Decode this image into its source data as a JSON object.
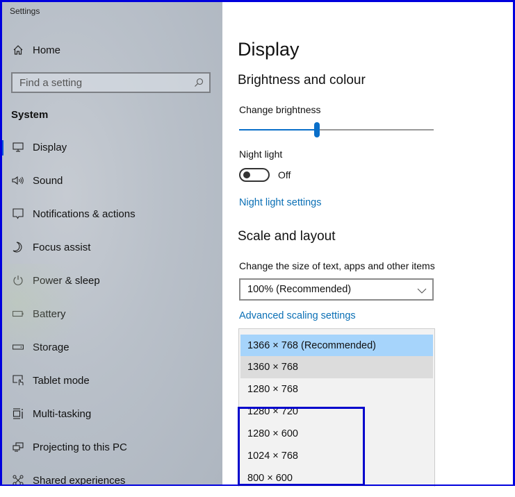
{
  "window": {
    "title": "Settings"
  },
  "sidebar": {
    "home_label": "Home",
    "search": {
      "placeholder": "Find a setting",
      "value": ""
    },
    "group_title": "System",
    "items": [
      {
        "label": "Display",
        "icon": "display-icon",
        "active": true
      },
      {
        "label": "Sound",
        "icon": "sound-icon"
      },
      {
        "label": "Notifications & actions",
        "icon": "notifications-icon"
      },
      {
        "label": "Focus assist",
        "icon": "moon-icon"
      },
      {
        "label": "Power & sleep",
        "icon": "power-icon"
      },
      {
        "label": "Battery",
        "icon": "battery-icon"
      },
      {
        "label": "Storage",
        "icon": "storage-icon"
      },
      {
        "label": "Tablet mode",
        "icon": "tablet-mode-icon"
      },
      {
        "label": "Multi-tasking",
        "icon": "multitasking-icon"
      },
      {
        "label": "Projecting to this PC",
        "icon": "projecting-icon"
      },
      {
        "label": "Shared experiences",
        "icon": "shared-experiences-icon"
      }
    ]
  },
  "main": {
    "page_title": "Display",
    "brightness_section": {
      "title": "Brightness and colour",
      "brightness_label": "Change brightness",
      "brightness_percent": 40,
      "night_light_label": "Night light",
      "night_light_state": "Off",
      "night_light_settings_link": "Night light settings"
    },
    "scale_section": {
      "title": "Scale and layout",
      "scale_label": "Change the size of text, apps and other items",
      "scale_value": "100% (Recommended)",
      "advanced_link": "Advanced scaling settings"
    },
    "resolution_dropdown": {
      "options": [
        "1366 × 768 (Recommended)",
        "1360 × 768",
        "1280 × 768",
        "1280 × 720",
        "1280 × 600",
        "1024 × 768",
        "800 × 600"
      ],
      "selected_index": 0,
      "hover_index": 1
    }
  },
  "colors": {
    "accent": "#0a6fc9",
    "link": "#0a6fb5",
    "selected_option": "#a6d4fb",
    "annotation_border": "#0000dd"
  }
}
